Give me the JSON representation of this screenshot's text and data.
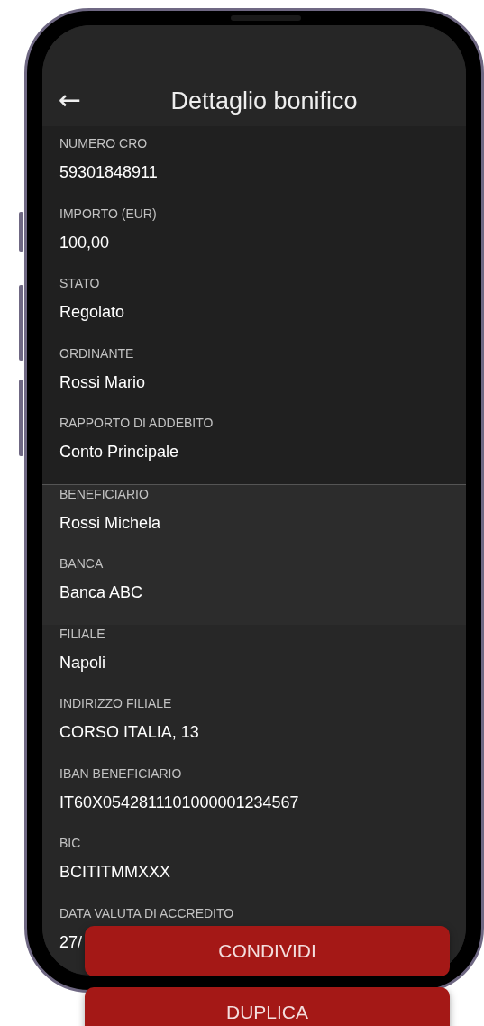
{
  "header": {
    "back_icon": "←",
    "title": "Dettaglio bonifico"
  },
  "groups": [
    {
      "fields": [
        {
          "label": "NUMERO CRO",
          "value": "59301848911"
        },
        {
          "label": "IMPORTO (EUR)",
          "value": "100,00"
        },
        {
          "label": "STATO",
          "value": "Regolato"
        },
        {
          "label": "ORDINANTE",
          "value": "Rossi Mario"
        },
        {
          "label": "RAPPORTO DI ADDEBITO",
          "value": "Conto Principale"
        }
      ]
    },
    {
      "fields": [
        {
          "label": "BENEFICIARIO",
          "value": "Rossi Michela"
        },
        {
          "label": "BANCA",
          "value": "Banca ABC"
        }
      ]
    },
    {
      "fields": [
        {
          "label": "FILIALE",
          "value": "Napoli"
        },
        {
          "label": "INDIRIZZO FILIALE",
          "value": "CORSO ITALIA, 13"
        },
        {
          "label": "IBAN BENEFICIARIO",
          "value": "IT60X0542811101000001234567"
        },
        {
          "label": "BIC",
          "value": "BCITITMMXXX"
        },
        {
          "label": "DATA VALUTA DI ACCREDITO",
          "value": "27/"
        }
      ]
    }
  ],
  "buttons": [
    {
      "label": "CONDIVIDI"
    },
    {
      "label": "DUPLICA"
    }
  ]
}
